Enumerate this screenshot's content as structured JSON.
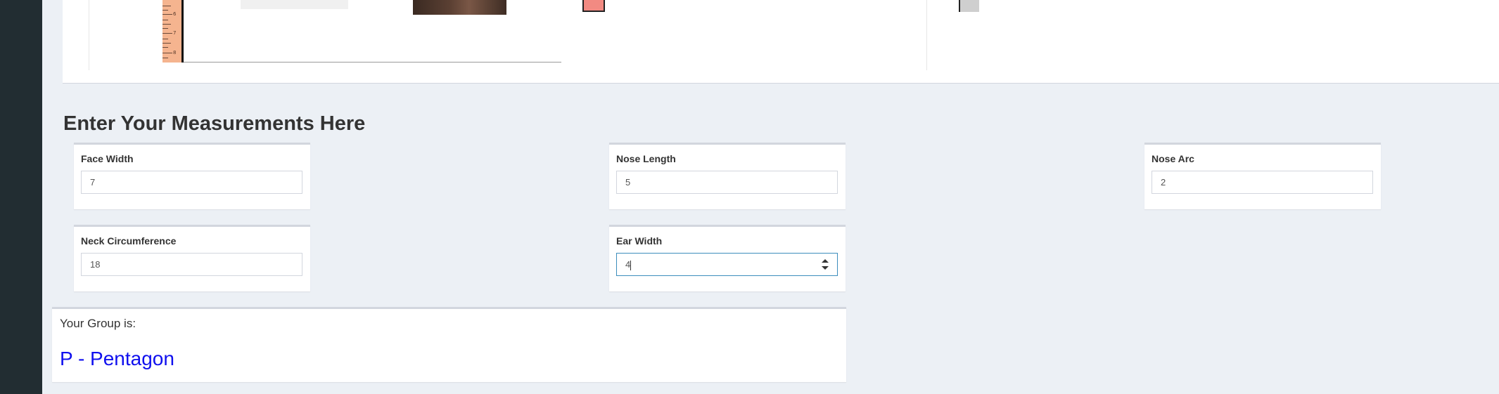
{
  "section": {
    "title": "Enter Your Measurements Here"
  },
  "fields": {
    "face_width": {
      "label": "Face Width",
      "value": "7"
    },
    "nose_length": {
      "label": "Nose Length",
      "value": "5"
    },
    "nose_arc": {
      "label": "Nose Arc",
      "value": "2"
    },
    "neck_circumference": {
      "label": "Neck Circumference",
      "value": "18"
    },
    "ear_width": {
      "label": "Ear Width",
      "value": "4"
    }
  },
  "result": {
    "label": "Your Group is:",
    "value": "P - Pentagon",
    "color": "#1010ee"
  },
  "ruler": {
    "numbers": [
      "6",
      "7",
      "8"
    ]
  },
  "colors": {
    "sidebar": "#222d32",
    "background": "#ecf0f5",
    "focus": "#3c8dbc"
  }
}
